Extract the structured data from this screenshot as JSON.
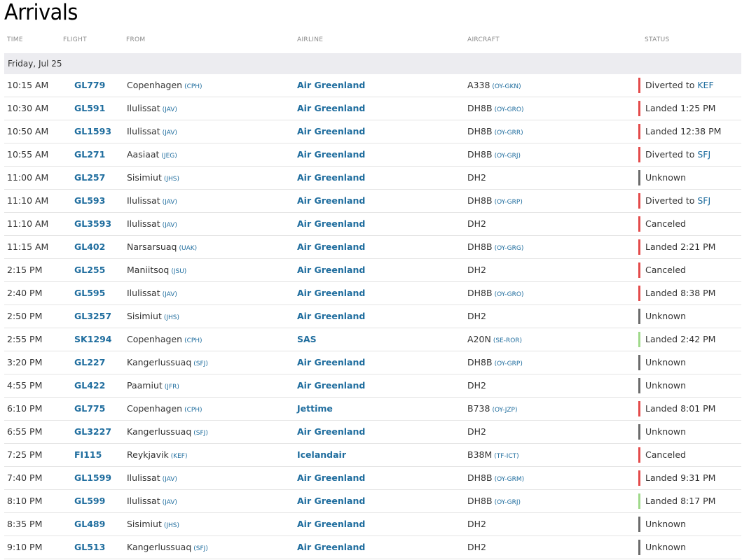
{
  "page": {
    "title": "Arrivals"
  },
  "columns": {
    "time": "TIME",
    "flight": "FLIGHT",
    "from": "FROM",
    "airline": "AIRLINE",
    "aircraft": "AIRCRAFT",
    "status": "STATUS"
  },
  "date_label": "Friday, Jul 25",
  "status_colors": {
    "red": "#e34a4a",
    "gray": "#6b6b6b",
    "green": "#9fd98a"
  },
  "link_color": "#1f6d9e",
  "flights": [
    {
      "time": "10:15 AM",
      "flight": "GL779",
      "from_city": "Copenhagen",
      "from_code": "(CPH)",
      "airline": "Air Greenland",
      "aircraft": "A338",
      "reg": "(OY-GKN)",
      "status": "Diverted to",
      "status_link": "KEF",
      "color": "red"
    },
    {
      "time": "10:30 AM",
      "flight": "GL591",
      "from_city": "Ilulissat",
      "from_code": "(JAV)",
      "airline": "Air Greenland",
      "aircraft": "DH8B",
      "reg": "(OY-GRO)",
      "status": "Landed 1:25 PM",
      "status_link": "",
      "color": "red"
    },
    {
      "time": "10:50 AM",
      "flight": "GL1593",
      "from_city": "Ilulissat",
      "from_code": "(JAV)",
      "airline": "Air Greenland",
      "aircraft": "DH8B",
      "reg": "(OY-GRR)",
      "status": "Landed 12:38 PM",
      "status_link": "",
      "color": "red"
    },
    {
      "time": "10:55 AM",
      "flight": "GL271",
      "from_city": "Aasiaat",
      "from_code": "(JEG)",
      "airline": "Air Greenland",
      "aircraft": "DH8B",
      "reg": "(OY-GRJ)",
      "status": "Diverted to",
      "status_link": "SFJ",
      "color": "red"
    },
    {
      "time": "11:00 AM",
      "flight": "GL257",
      "from_city": "Sisimiut",
      "from_code": "(JHS)",
      "airline": "Air Greenland",
      "aircraft": "DH2",
      "reg": "",
      "status": "Unknown",
      "status_link": "",
      "color": "gray"
    },
    {
      "time": "11:10 AM",
      "flight": "GL593",
      "from_city": "Ilulissat",
      "from_code": "(JAV)",
      "airline": "Air Greenland",
      "aircraft": "DH8B",
      "reg": "(OY-GRP)",
      "status": "Diverted to",
      "status_link": "SFJ",
      "color": "red"
    },
    {
      "time": "11:10 AM",
      "flight": "GL3593",
      "from_city": "Ilulissat",
      "from_code": "(JAV)",
      "airline": "Air Greenland",
      "aircraft": "DH2",
      "reg": "",
      "status": "Canceled",
      "status_link": "",
      "color": "red"
    },
    {
      "time": "11:15 AM",
      "flight": "GL402",
      "from_city": "Narsarsuaq",
      "from_code": "(UAK)",
      "airline": "Air Greenland",
      "aircraft": "DH8B",
      "reg": "(OY-GRG)",
      "status": "Landed 2:21 PM",
      "status_link": "",
      "color": "red"
    },
    {
      "time": "2:15 PM",
      "flight": "GL255",
      "from_city": "Maniitsoq",
      "from_code": "(JSU)",
      "airline": "Air Greenland",
      "aircraft": "DH2",
      "reg": "",
      "status": "Canceled",
      "status_link": "",
      "color": "red"
    },
    {
      "time": "2:40 PM",
      "flight": "GL595",
      "from_city": "Ilulissat",
      "from_code": "(JAV)",
      "airline": "Air Greenland",
      "aircraft": "DH8B",
      "reg": "(OY-GRO)",
      "status": "Landed 8:38 PM",
      "status_link": "",
      "color": "red"
    },
    {
      "time": "2:50 PM",
      "flight": "GL3257",
      "from_city": "Sisimiut",
      "from_code": "(JHS)",
      "airline": "Air Greenland",
      "aircraft": "DH2",
      "reg": "",
      "status": "Unknown",
      "status_link": "",
      "color": "gray"
    },
    {
      "time": "2:55 PM",
      "flight": "SK1294",
      "from_city": "Copenhagen",
      "from_code": "(CPH)",
      "airline": "SAS",
      "aircraft": "A20N",
      "reg": "(SE-ROR)",
      "status": "Landed 2:42 PM",
      "status_link": "",
      "color": "green"
    },
    {
      "time": "3:20 PM",
      "flight": "GL227",
      "from_city": "Kangerlussuaq",
      "from_code": "(SFJ)",
      "airline": "Air Greenland",
      "aircraft": "DH8B",
      "reg": "(OY-GRP)",
      "status": "Unknown",
      "status_link": "",
      "color": "gray"
    },
    {
      "time": "4:55 PM",
      "flight": "GL422",
      "from_city": "Paamiut",
      "from_code": "(JFR)",
      "airline": "Air Greenland",
      "aircraft": "DH2",
      "reg": "",
      "status": "Unknown",
      "status_link": "",
      "color": "gray"
    },
    {
      "time": "6:10 PM",
      "flight": "GL775",
      "from_city": "Copenhagen",
      "from_code": "(CPH)",
      "airline": "Jettime",
      "aircraft": "B738",
      "reg": "(OY-JZP)",
      "status": "Landed 8:01 PM",
      "status_link": "",
      "color": "red"
    },
    {
      "time": "6:55 PM",
      "flight": "GL3227",
      "from_city": "Kangerlussuaq",
      "from_code": "(SFJ)",
      "airline": "Air Greenland",
      "aircraft": "DH2",
      "reg": "",
      "status": "Unknown",
      "status_link": "",
      "color": "gray"
    },
    {
      "time": "7:25 PM",
      "flight": "FI115",
      "from_city": "Reykjavik",
      "from_code": "(KEF)",
      "airline": "Icelandair",
      "aircraft": "B38M",
      "reg": "(TF-ICT)",
      "status": "Canceled",
      "status_link": "",
      "color": "red"
    },
    {
      "time": "7:40 PM",
      "flight": "GL1599",
      "from_city": "Ilulissat",
      "from_code": "(JAV)",
      "airline": "Air Greenland",
      "aircraft": "DH8B",
      "reg": "(OY-GRM)",
      "status": "Landed 9:31 PM",
      "status_link": "",
      "color": "red"
    },
    {
      "time": "8:10 PM",
      "flight": "GL599",
      "from_city": "Ilulissat",
      "from_code": "(JAV)",
      "airline": "Air Greenland",
      "aircraft": "DH8B",
      "reg": "(OY-GRJ)",
      "status": "Landed 8:17 PM",
      "status_link": "",
      "color": "green"
    },
    {
      "time": "8:35 PM",
      "flight": "GL489",
      "from_city": "Sisimiut",
      "from_code": "(JHS)",
      "airline": "Air Greenland",
      "aircraft": "DH2",
      "reg": "",
      "status": "Unknown",
      "status_link": "",
      "color": "gray"
    },
    {
      "time": "9:10 PM",
      "flight": "GL513",
      "from_city": "Kangerlussuaq",
      "from_code": "(SFJ)",
      "airline": "Air Greenland",
      "aircraft": "DH2",
      "reg": "",
      "status": "Unknown",
      "status_link": "",
      "color": "gray"
    }
  ]
}
